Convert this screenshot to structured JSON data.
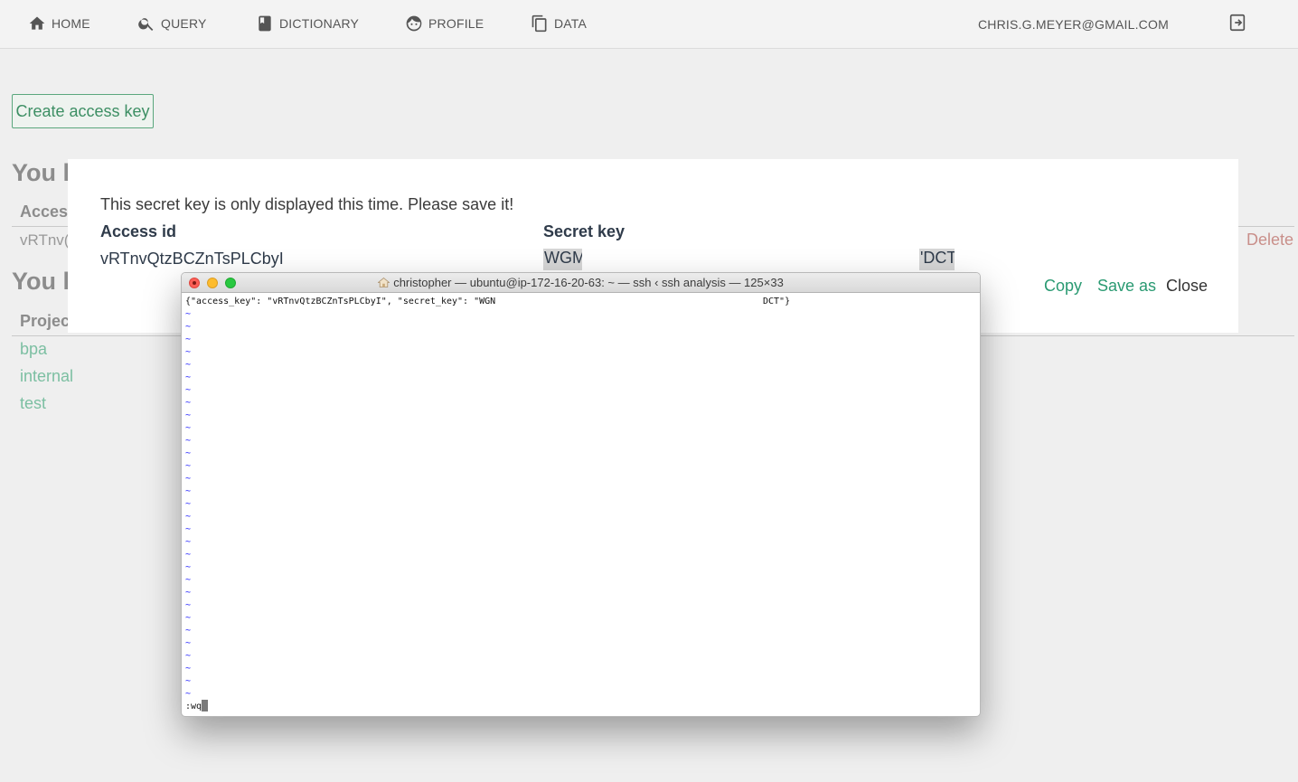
{
  "nav": {
    "items": [
      {
        "label": "HOME",
        "icon": "home-icon"
      },
      {
        "label": "QUERY",
        "icon": "search-icon"
      },
      {
        "label": "DICTIONARY",
        "icon": "book-icon"
      },
      {
        "label": "PROFILE",
        "icon": "face-icon"
      },
      {
        "label": "DATA",
        "icon": "copy-icon"
      }
    ],
    "email": "CHRIS.G.MEYER@GMAIL.COM",
    "logout_icon": "logout-icon"
  },
  "page": {
    "create_button": "Create access key",
    "heading_keys": "You h",
    "heading_projects": "You h",
    "col_access": "Access",
    "key_partial": "vRTnv(",
    "delete_label": "Delete",
    "col_project": "Projec",
    "projects": [
      "bpa",
      "internal",
      "test"
    ]
  },
  "modal": {
    "message": "This secret key is only displayed this time. Please save it!",
    "header_access": "Access id",
    "header_secret": "Secret key",
    "access_id": "vRTnvQtzBCZnTsPLCbyI",
    "secret_start": "WGM",
    "secret_end": "'DCT",
    "actions": {
      "copy": "Copy",
      "save_as": "Save as",
      "close": "Close"
    }
  },
  "terminal": {
    "title": "christopher — ubuntu@ip-172-16-20-63: ~ — ssh ‹ ssh analysis — 125×33",
    "json_left": "{\"access_key\": \"vRTnvQtzBCZnTsPLCbyI\", \"secret_key\": \"WGN",
    "json_right": "DCT\"}",
    "tilde": "~",
    "tilde_count": 31,
    "command": ":wq"
  },
  "colors": {
    "accent_green": "#2a9a72",
    "delete_red": "#c98f8a",
    "link_green": "#7cbfa2"
  }
}
